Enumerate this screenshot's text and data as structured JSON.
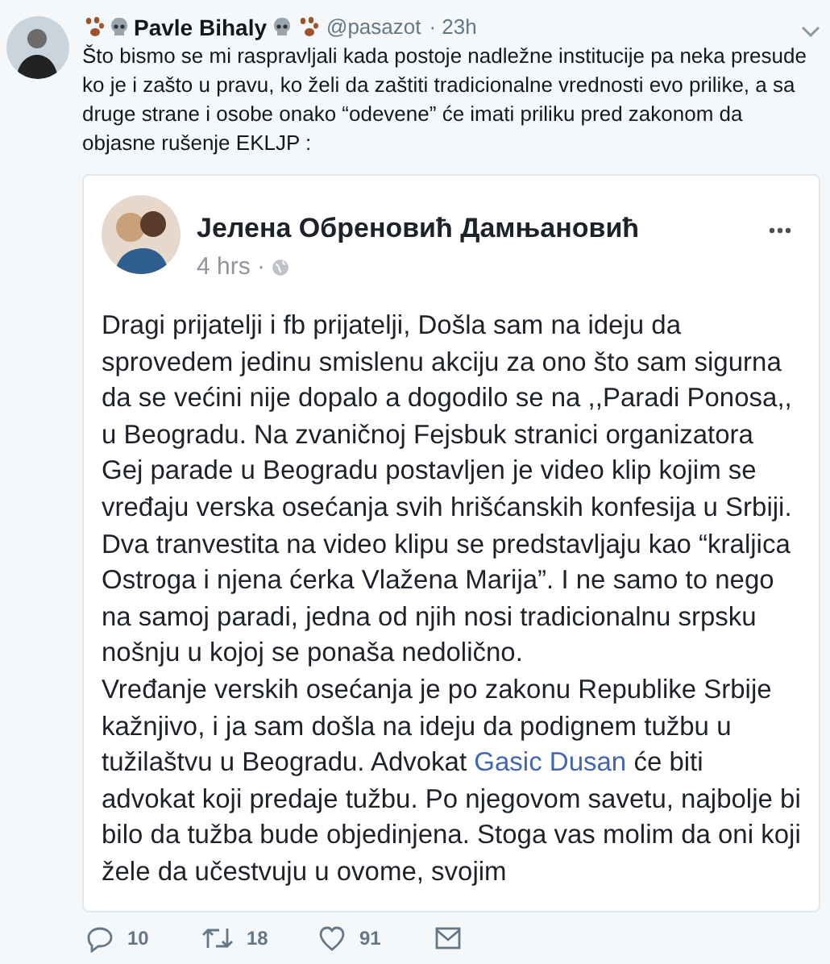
{
  "tweet": {
    "name": "Pavle Bihaly",
    "handle": "@pasazot",
    "time": "· 23h",
    "text": "Što bismo se mi raspravljali kada postoje nadležne institucije pa neka presude ko je i zašto u pravu, ko želi da zaštiti tradicionalne vrednosti evo prilike, a sa druge strane i osobe onako “odevene” će imati priliku pred zakonom da objasne rušenje EKLJP  :"
  },
  "embedded_post": {
    "author": "Јелена Обреновић Дамњановић",
    "time": "4 hrs ·",
    "paragraphs": [
      {
        "text": "Dragi prijatelji i fb prijatelji, Došla sam na ideju da sprovedem jedinu smislenu akciju za ono što sam sigurna da se većini nije dopalo a dogodilo se na ,,Paradi Ponosa,, u Beogradu. Na zvaničnoj Fejsbuk stranici organizatora Gej parade u Beogradu postavljen je video klip kojim se vređaju verska osećanja svih hrišćanskih konfesija u Srbiji."
      },
      {
        "text": "Dva tranvestita na video klipu se predstavljaju kao “kraljica Ostroga i njena ćerka Vlažena Marija”. I ne samo to nego na samoj paradi, jedna od njih nosi tradicionalnu srpsku nošnju u kojoj se ponaša nedolično."
      },
      {
        "text": "Vređanje verskih osećanja je po zakonu Republike Srbije kažnjivo, i ja sam došla na ideju da podignem tužbu u tužilaštvu u Beogradu. Advokat ",
        "link": "Gasic Dusan",
        "text_after": " će biti advokat koji predaje tužbu. Po njegovom savetu, najbolje bi bilo da tužba bude objedinjena. Stoga vas molim da oni koji žele da učestvuju u ovome, svojim"
      }
    ]
  },
  "actions": [
    {
      "kind": "reply",
      "count": "10"
    },
    {
      "kind": "retweet",
      "count": "18"
    },
    {
      "kind": "like",
      "count": "91"
    },
    {
      "kind": "message"
    }
  ]
}
